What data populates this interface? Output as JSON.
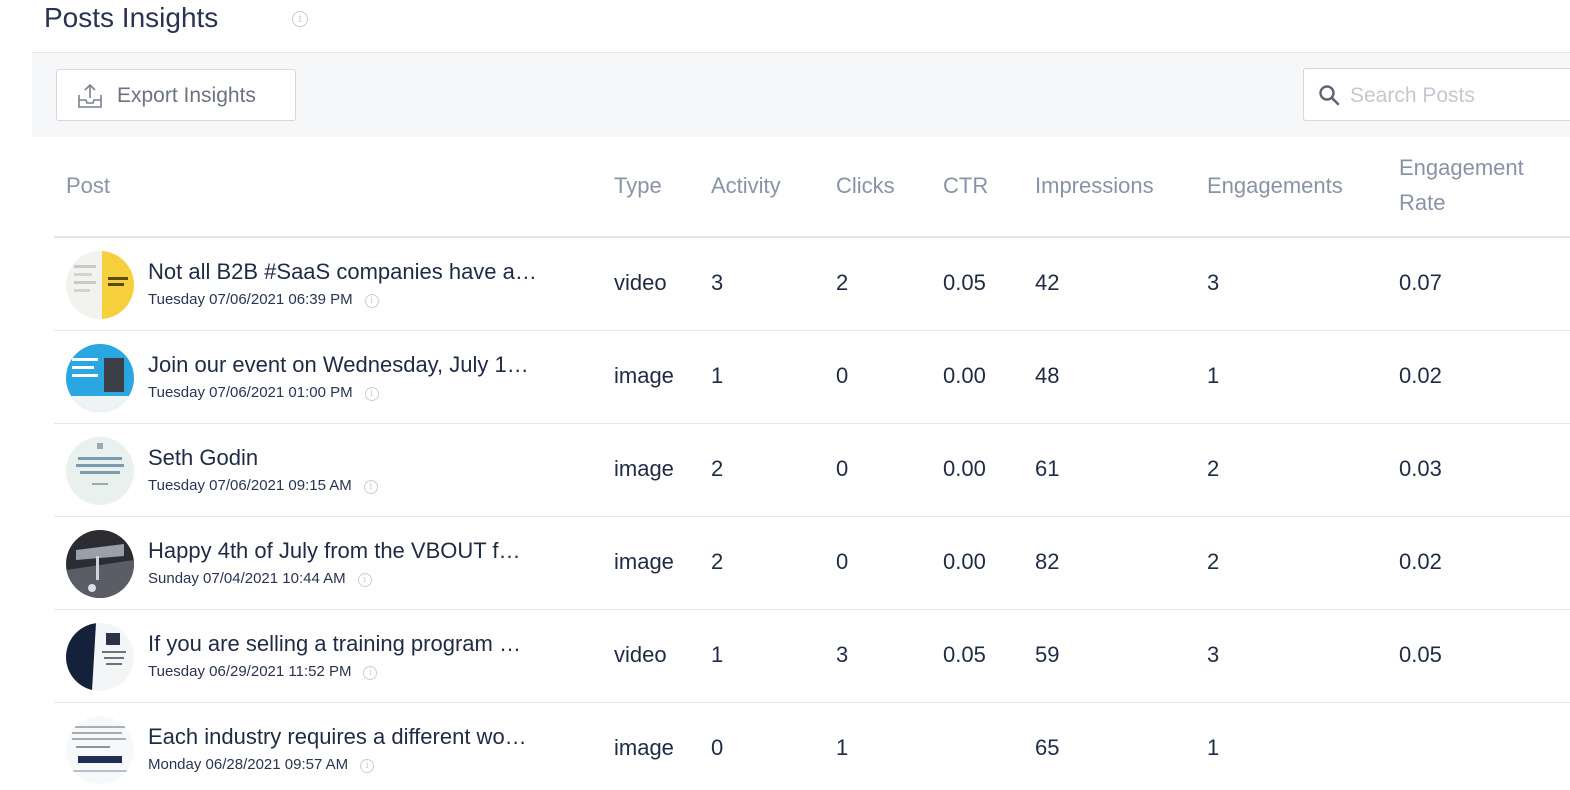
{
  "header": {
    "title": "Posts Insights",
    "info_icon": "info-circle-icon"
  },
  "toolbar": {
    "export_label": "Export Insights",
    "export_icon": "upload-tray-icon",
    "search_placeholder": "Search Posts",
    "search_value": "",
    "search_icon": "search-icon"
  },
  "table": {
    "columns": {
      "post": "Post",
      "type": "Type",
      "activity": "Activity",
      "clicks": "Clicks",
      "ctr": "CTR",
      "impressions": "Impressions",
      "engagements": "Engagements",
      "engagement_rate_line1": "Engagement",
      "engagement_rate_line2": "Rate"
    },
    "rows": [
      {
        "title": "Not all B2B #SaaS companies have a…",
        "date": "Tuesday 07/06/2021 06:39 PM",
        "type": "video",
        "activity": "3",
        "clicks": "2",
        "ctr": "0.05",
        "impressions": "42",
        "engagements": "3",
        "engagement_rate": "0.07"
      },
      {
        "title": "Join our event on Wednesday, July 1…",
        "date": "Tuesday 07/06/2021 01:00 PM",
        "type": "image",
        "activity": "1",
        "clicks": "0",
        "ctr": "0.00",
        "impressions": "48",
        "engagements": "1",
        "engagement_rate": "0.02"
      },
      {
        "title": "Seth Godin",
        "date": "Tuesday 07/06/2021 09:15 AM",
        "type": "image",
        "activity": "2",
        "clicks": "0",
        "ctr": "0.00",
        "impressions": "61",
        "engagements": "2",
        "engagement_rate": "0.03"
      },
      {
        "title": "Happy 4th of July from the VBOUT f…",
        "date": "Sunday 07/04/2021 10:44 AM",
        "type": "image",
        "activity": "2",
        "clicks": "0",
        "ctr": "0.00",
        "impressions": "82",
        "engagements": "2",
        "engagement_rate": "0.02"
      },
      {
        "title": "If you are selling a training program …",
        "date": "Tuesday 06/29/2021 11:52 PM",
        "type": "video",
        "activity": "1",
        "clicks": "3",
        "ctr": "0.05",
        "impressions": "59",
        "engagements": "3",
        "engagement_rate": "0.05"
      },
      {
        "title": "Each industry requires a different wo…",
        "date": "Monday 06/28/2021 09:57 AM",
        "type": "image",
        "activity": "0",
        "clicks": "1",
        "ctr": "",
        "impressions": "65",
        "engagements": "1",
        "engagement_rate": ""
      }
    ]
  },
  "colors": {
    "text": "#1f2a44",
    "header_text": "#8a93a6",
    "toolbar_bg": "#f6f7f9",
    "border": "#e1e4e8"
  }
}
